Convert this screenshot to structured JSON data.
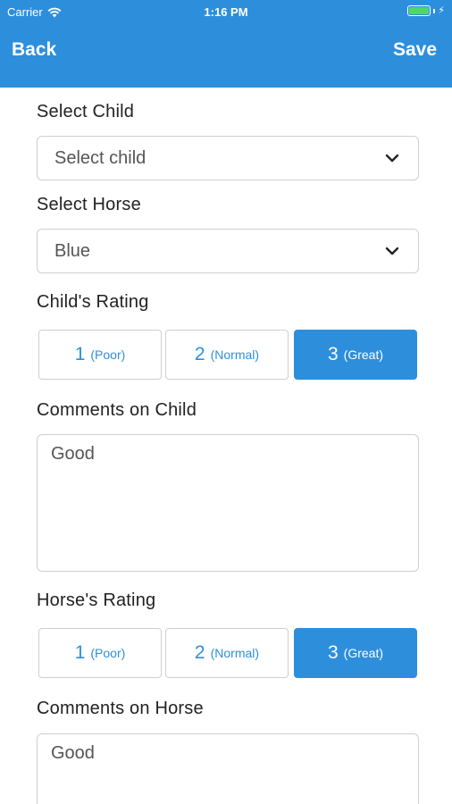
{
  "status_bar": {
    "carrier": "Carrier",
    "time": "1:16 PM"
  },
  "nav": {
    "back_label": "Back",
    "save_label": "Save"
  },
  "form": {
    "child": {
      "label": "Select Child",
      "value": "Select child"
    },
    "horse": {
      "label": "Select Horse",
      "value": "Blue"
    },
    "child_rating": {
      "label": "Child's Rating",
      "options": [
        {
          "num": "1",
          "desc": "(Poor)"
        },
        {
          "num": "2",
          "desc": "(Normal)"
        },
        {
          "num": "3",
          "desc": "(Great)"
        }
      ],
      "selected": 3
    },
    "child_comments": {
      "label": "Comments on Child",
      "value": "Good"
    },
    "horse_rating": {
      "label": "Horse's Rating",
      "options": [
        {
          "num": "1",
          "desc": "(Poor)"
        },
        {
          "num": "2",
          "desc": "(Normal)"
        },
        {
          "num": "3",
          "desc": "(Great)"
        }
      ],
      "selected": 3
    },
    "horse_comments": {
      "label": "Comments on Horse",
      "value": "Good"
    }
  },
  "colors": {
    "accent": "#2d8fdc",
    "border": "#cfcfcf",
    "battery": "#4cd964"
  }
}
